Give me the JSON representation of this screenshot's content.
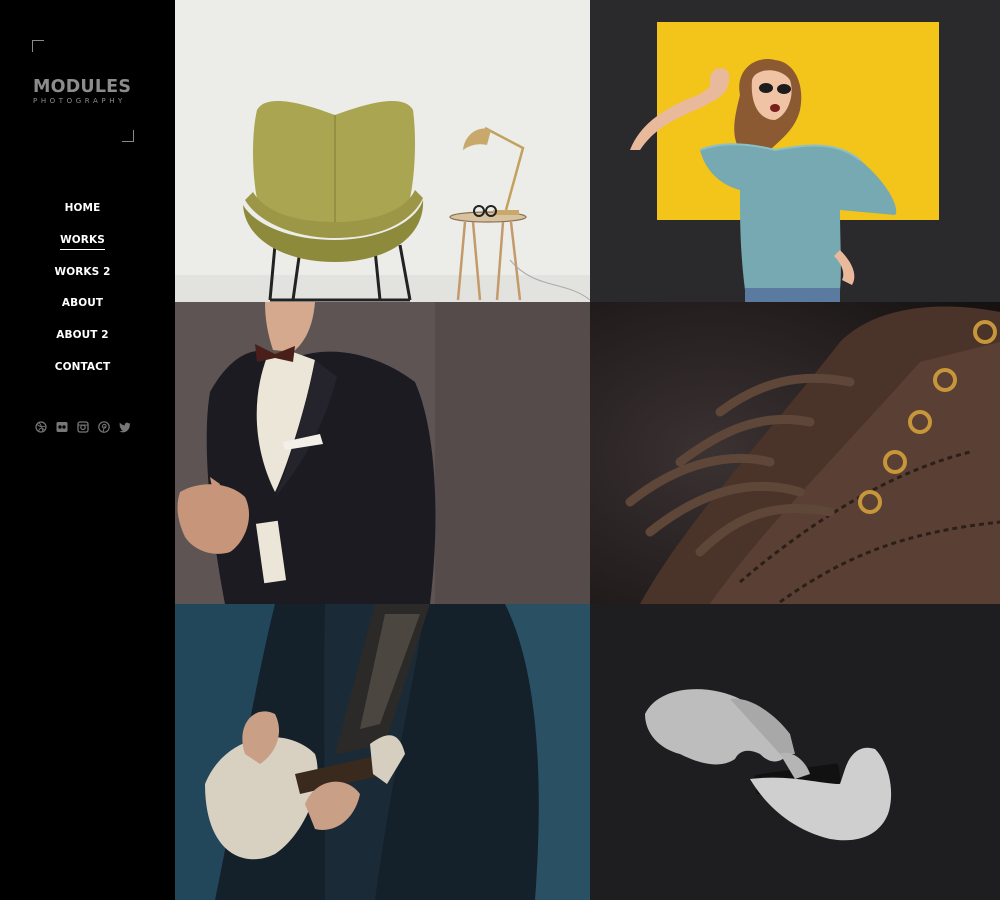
{
  "brand": {
    "title": "MODULES",
    "subtitle": "PHOTOGRAPHY"
  },
  "nav": {
    "items": [
      "HOME",
      "WORKS",
      "WORKS 2",
      "ABOUT",
      "ABOUT 2",
      "CONTACT"
    ],
    "active": "WORKS"
  },
  "social": [
    "dribbble-icon",
    "flickr-icon",
    "instagram-icon",
    "pinterest-icon",
    "twitter-icon"
  ],
  "gallery": [
    {
      "name": "photo-chair-lamp",
      "bg": "#ececea"
    },
    {
      "name": "photo-woman-yellow-wall",
      "bg": "#2b2b2d"
    },
    {
      "name": "photo-man-suit",
      "bg": "#5c5352"
    },
    {
      "name": "photo-boot-laces",
      "bg": "#1f1a1a"
    },
    {
      "name": "photo-guitarist",
      "bg": "#1f3a4a"
    },
    {
      "name": "photo-hands-phone",
      "bg": "#1e1d1f"
    }
  ],
  "colors": {
    "sidebar": "#000000",
    "logo": "#8c8c8c",
    "nav_text": "#ffffff",
    "yellow": "#f5c518"
  }
}
